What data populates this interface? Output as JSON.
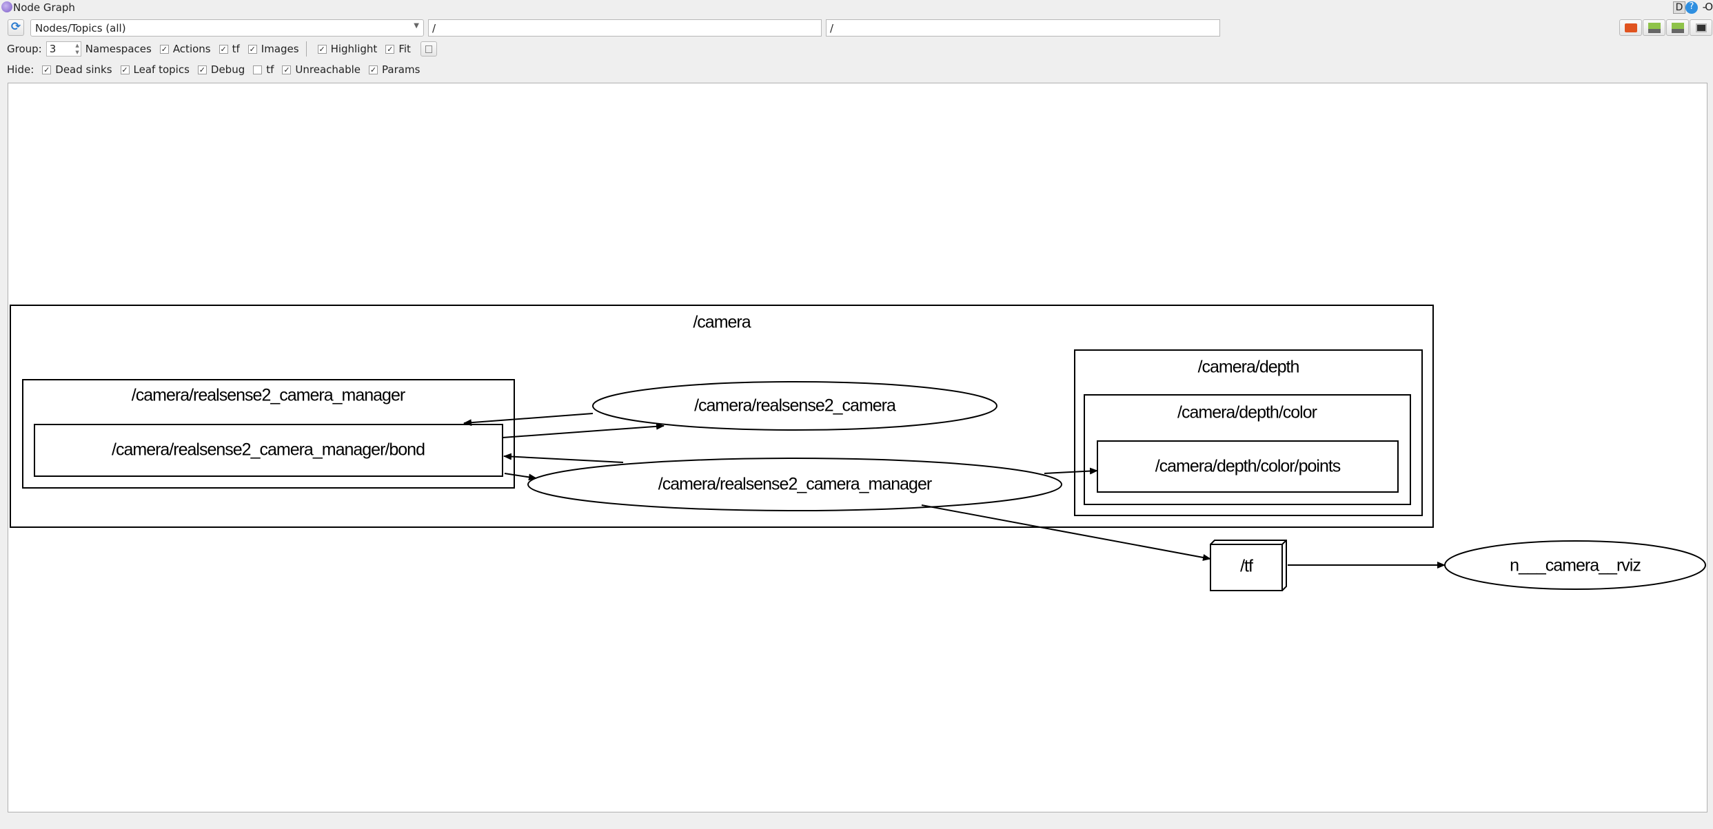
{
  "window": {
    "title": "Node Graph",
    "right_controls": [
      "D",
      "?",
      "-",
      "O"
    ]
  },
  "toolbar": {
    "view_mode": "Nodes/Topics (all)",
    "ns_filter": "/",
    "topic_filter": "/",
    "group_label": "Group:",
    "group_value": "3",
    "options": [
      {
        "label": "Namespaces",
        "checked": null
      },
      {
        "label": "Actions",
        "checked": true
      },
      {
        "label": "tf",
        "checked": true
      },
      {
        "label": "Images",
        "checked": true
      }
    ],
    "options2": [
      {
        "label": "Highlight",
        "checked": true
      },
      {
        "label": "Fit",
        "checked": true
      }
    ],
    "hide_label": "Hide:",
    "hide": [
      {
        "label": "Dead sinks",
        "checked": true
      },
      {
        "label": "Leaf topics",
        "checked": true
      },
      {
        "label": "Debug",
        "checked": true
      },
      {
        "label": "tf",
        "checked": false
      },
      {
        "label": "Unreachable",
        "checked": true
      },
      {
        "label": "Params",
        "checked": true
      }
    ]
  },
  "graph": {
    "clusters": {
      "camera": "/camera",
      "manager": "/camera/realsense2_camera_manager",
      "depth": "/camera/depth",
      "depth_color": "/camera/depth/color"
    },
    "nodes": {
      "bond": "/camera/realsense2_camera_manager/bond",
      "rs_camera": "/camera/realsense2_camera",
      "rs_manager": "/camera/realsense2_camera_manager",
      "points": "/camera/depth/color/points",
      "tf": "/tf",
      "rviz": "n___camera__rviz"
    }
  }
}
